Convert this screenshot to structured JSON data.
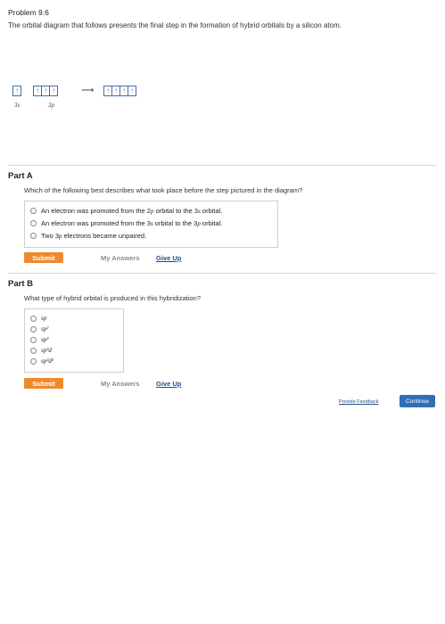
{
  "problem": {
    "title": "Problem 9.6",
    "intro": "The orbital diagram that follows presents the final step in the formation of hybrid orbitals by a silicon atom."
  },
  "diagram": {
    "left_3s": [
      "↑"
    ],
    "left_3p": [
      "↑",
      "↑",
      "↑"
    ],
    "arrow": "⟶",
    "right": [
      "↑",
      "↑",
      "↑",
      "↑"
    ],
    "label_3s": "3s",
    "label_3p": "3p"
  },
  "part_a": {
    "heading": "Part A",
    "question": "Which of the following best describes what took place before the step pictured in the diagram?",
    "options": [
      {
        "pre": "An electron was promoted from the 2",
        "sub": "p",
        "mid": " orbital to the 3",
        "sub2": "s",
        "post": " orbital."
      },
      {
        "pre": "An electron was promoted from the 3",
        "sub": "s",
        "mid": " orbital to the 3",
        "sub2": "p",
        "post": " orbital."
      },
      {
        "pre": "Two 3",
        "sub": "p",
        "mid": " electrons became unpaired.",
        "sub2": "",
        "post": ""
      }
    ],
    "submit": "Submit",
    "my_answers": "My Answers",
    "give_up": "Give Up"
  },
  "part_b": {
    "heading": "Part B",
    "question": "What type of hybrid orbital is produced in this hybridization?",
    "options": [
      "sp",
      "sp²",
      "sp³",
      "sp³d",
      "sp³d²"
    ],
    "submit": "Submit",
    "my_answers": "My Answers",
    "give_up": "Give Up"
  },
  "footer": {
    "feedback": "Provide Feedback",
    "continue": "Continue"
  }
}
